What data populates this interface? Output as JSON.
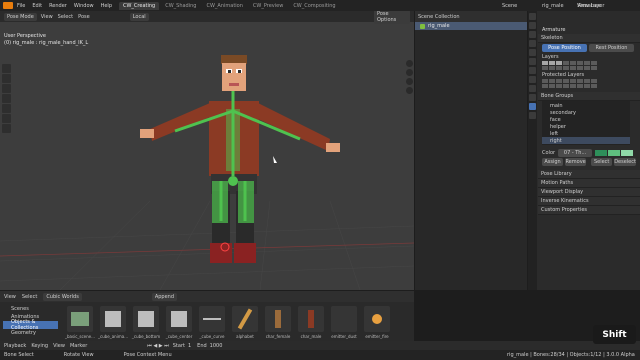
{
  "topbar": {
    "menus": [
      "File",
      "Edit",
      "Render",
      "Window",
      "Help"
    ],
    "workspaces": [
      "CW_Creating",
      "CW_Shading",
      "CW_Animation",
      "CW_Preview",
      "CW_Compositing"
    ],
    "scene_label": "Scene",
    "view_layer_label": "View Layer"
  },
  "viewport": {
    "mode": "Pose Mode",
    "menus": [
      "View",
      "Select",
      "Pose"
    ],
    "transform": "Local",
    "pose_options": "Pose Options",
    "info_line1": "User Perspective",
    "info_line2": "(0) rig_male : rig_male_hand_IK_L"
  },
  "outliner": {
    "title": "Scene Collection",
    "items": [
      "rig_male"
    ]
  },
  "properties": {
    "object_name": "rig_male",
    "data_name": "Armature",
    "armature_label": "Armature",
    "skeleton": "Skeleton",
    "pose_position": "Pose Position",
    "rest_position": "Rest Position",
    "layers": "Layers",
    "protected_layers": "Protected Layers",
    "bone_groups": "Bone Groups",
    "groups": [
      "main",
      "secondary",
      "face",
      "helper",
      "left",
      "right"
    ],
    "color_label": "Color",
    "color_value": "07 - Th...",
    "buttons": [
      "Assign",
      "Remove",
      "Select",
      "Deselect"
    ],
    "panels": [
      "Pose Library",
      "Motion Paths",
      "Viewport Display",
      "Inverse Kinematics",
      "Custom Properties"
    ]
  },
  "asset_browser": {
    "menus": [
      "View",
      "Select"
    ],
    "library": "Cubic Worlds",
    "import": "Append",
    "sidebar": [
      "Scenes",
      "Animations",
      "Objects & Collections",
      "Geometry"
    ],
    "assets": [
      "_basic_scene...",
      "_cube_anima...",
      "_cube_bottom",
      "_cube_center",
      "_cube_curve",
      "alphabet",
      "char_female",
      "char_male",
      "emitter_dust",
      "emitter_fire"
    ]
  },
  "timeline": {
    "playback": "Playback",
    "keying": "Keying",
    "view": "View",
    "marker": "Marker",
    "start_label": "Start",
    "start_value": "1",
    "end_label": "End",
    "end_value": "1000"
  },
  "status": {
    "left": "Bone Select",
    "middle": "Rotate View",
    "context": "Pose Context Menu",
    "right": "rig_male | Bones:28/34 | Objects:1/12 | 3.0.0 Alpha"
  },
  "key_overlay": "Shift",
  "colors": {
    "accent": "#4772b3",
    "bone_green": "#4fc24f"
  }
}
